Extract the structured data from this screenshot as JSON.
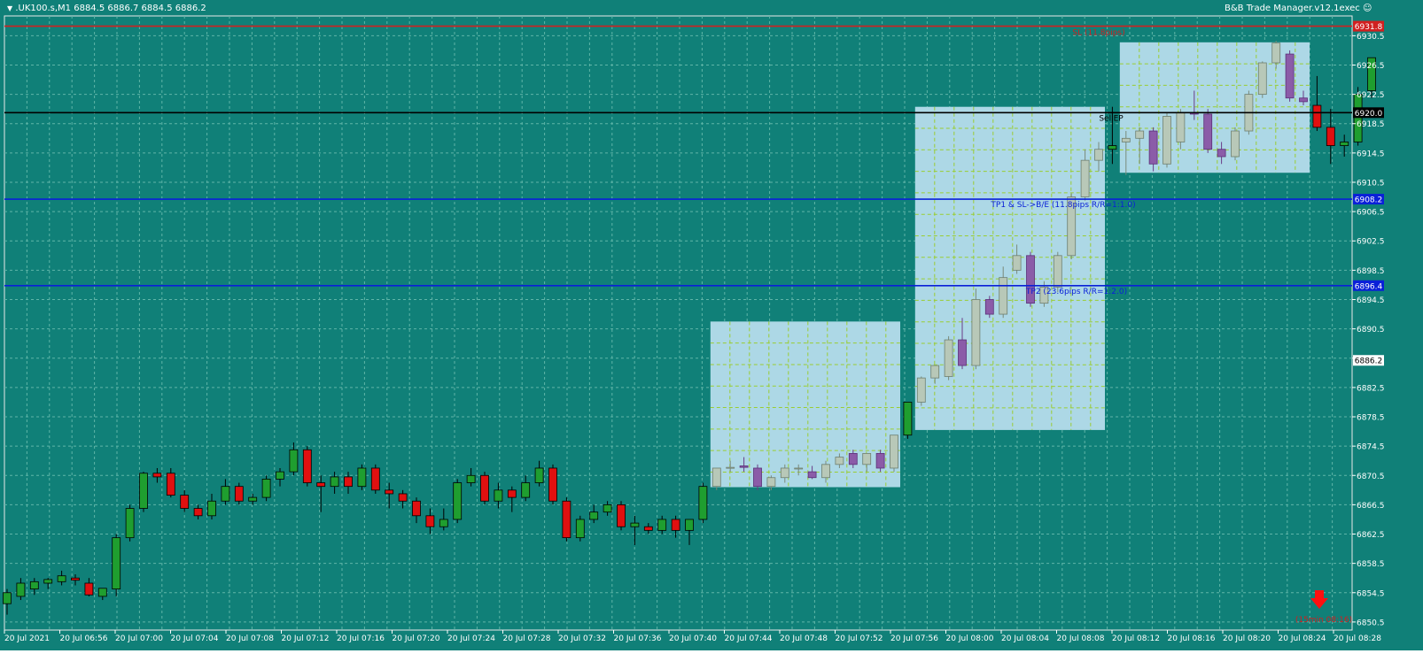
{
  "header": {
    "symbol_info": ".UK100.s,M1  6884.5 6886.7 6884.5 6886.2",
    "expert_name": "B&B Trade Manager.v12.1exec"
  },
  "colors": {
    "background": "#108078",
    "grid": "#5fb5a8",
    "bull": "#1f9e2f",
    "bear": "#e01010",
    "box_fill": "#add8e6",
    "box_grid": "#9acd32",
    "box_bull": "#b8c8b8",
    "box_bear": "#8b5ca8",
    "sl_line": "#d02020",
    "entry_line": "#000000",
    "tp_line": "#0a20d8"
  },
  "price_axis": {
    "ticks": [
      "6930.5",
      "6926.5",
      "6922.5",
      "6918.5",
      "6914.5",
      "6910.5",
      "6906.5",
      "6902.5",
      "6898.5",
      "6894.5",
      "6890.5",
      "6886.5",
      "6882.5",
      "6878.5",
      "6874.5",
      "6870.5",
      "6866.5",
      "6862.5",
      "6858.5",
      "6854.5",
      "6850.5"
    ]
  },
  "time_axis": {
    "labels": [
      "20 Jul 2021",
      "20 Jul 06:56",
      "20 Jul 07:00",
      "20 Jul 07:04",
      "20 Jul 07:08",
      "20 Jul 07:12",
      "20 Jul 07:16",
      "20 Jul 07:20",
      "20 Jul 07:24",
      "20 Jul 07:28",
      "20 Jul 07:32",
      "20 Jul 07:36",
      "20 Jul 07:40",
      "20 Jul 07:44",
      "20 Jul 07:48",
      "20 Jul 07:52",
      "20 Jul 07:56",
      "20 Jul 08:00",
      "20 Jul 08:04",
      "20 Jul 08:08",
      "20 Jul 08:12",
      "20 Jul 08:16",
      "20 Jul 08:20",
      "20 Jul 08:24",
      "20 Jul 08:28"
    ]
  },
  "levels": [
    {
      "name": "sl",
      "price": 6931.8,
      "label": "6931.8",
      "text": "SL (11.8pips)",
      "color": "#d02020",
      "text_color": "#d02020",
      "tag_fill": "#d02020"
    },
    {
      "name": "entry",
      "price": 6920.0,
      "label": "6920.0",
      "text": "SellEP",
      "color": "#000000",
      "text_color": "#000000",
      "tag_fill": "#000000"
    },
    {
      "name": "tp1",
      "price": 6908.2,
      "label": "6908.2",
      "text": "TP1 & SL->B/E (11.8pips R/R=1:1.0)",
      "color": "#0a20d8",
      "text_color": "#0a20d8",
      "tag_fill": "#0a20d8"
    },
    {
      "name": "tp2",
      "price": 6896.4,
      "label": "6896.4",
      "text": "TP2 (23.6pips R/R=1:2.0)",
      "color": "#0a20d8",
      "text_color": "#0a20d8",
      "tag_fill": "#0a20d8"
    }
  ],
  "current_price": "6886.2",
  "timer_text": "(15min 08:16)",
  "boxes": [
    {
      "from_bar": 52,
      "to_bar": 65,
      "top": 6891.5,
      "bottom": 6868.9
    },
    {
      "from_bar": 67,
      "to_bar": 80,
      "top": 6920.8,
      "bottom": 6876.7
    },
    {
      "from_bar": 82,
      "to_bar": 95,
      "top": 6929.6,
      "bottom": 6911.8
    }
  ],
  "candles": [
    [
      6853.0,
      6855.0,
      6851.5,
      6854.5
    ],
    [
      6854.0,
      6856.5,
      6853.5,
      6855.8
    ],
    [
      6855.0,
      6856.5,
      6854.2,
      6856.0
    ],
    [
      6855.8,
      6856.5,
      6855.0,
      6856.3
    ],
    [
      6856.0,
      6857.5,
      6855.5,
      6856.8
    ],
    [
      6856.5,
      6857.0,
      6855.5,
      6856.2
    ],
    [
      6855.8,
      6856.5,
      6854.0,
      6854.2
    ],
    [
      6854.0,
      6855.0,
      6853.5,
      6855.1
    ],
    [
      6855.0,
      6862.5,
      6854.0,
      6862.0
    ],
    [
      6862.0,
      6866.5,
      6861.5,
      6866.0
    ],
    [
      6866.0,
      6871.0,
      6865.5,
      6870.8
    ],
    [
      6870.8,
      6871.5,
      6869.5,
      6870.3
    ],
    [
      6870.8,
      6871.5,
      6867.5,
      6867.8
    ],
    [
      6867.8,
      6868.5,
      6865.5,
      6866.0
    ],
    [
      6866.0,
      6866.5,
      6864.5,
      6865.0
    ],
    [
      6865.0,
      6868.0,
      6864.5,
      6867.0
    ],
    [
      6867.0,
      6870.0,
      6866.5,
      6869.0
    ],
    [
      6869.0,
      6869.5,
      6866.5,
      6867.0
    ],
    [
      6867.0,
      6868.0,
      6866.5,
      6867.5
    ],
    [
      6867.5,
      6870.5,
      6867.0,
      6870.0
    ],
    [
      6870.0,
      6871.5,
      6869.0,
      6871.0
    ],
    [
      6871.0,
      6875.0,
      6870.5,
      6874.0
    ],
    [
      6874.0,
      6874.5,
      6869.0,
      6869.5
    ],
    [
      6869.5,
      6870.5,
      6865.5,
      6869.0
    ],
    [
      6869.0,
      6871.0,
      6868.0,
      6870.3
    ],
    [
      6870.3,
      6871.0,
      6868.0,
      6869.0
    ],
    [
      6869.0,
      6872.0,
      6868.5,
      6871.5
    ],
    [
      6871.5,
      6872.0,
      6868.0,
      6868.5
    ],
    [
      6868.5,
      6869.5,
      6866.0,
      6868.0
    ],
    [
      6868.0,
      6868.5,
      6866.0,
      6867.0
    ],
    [
      6867.0,
      6867.5,
      6864.0,
      6865.0
    ],
    [
      6865.0,
      6866.0,
      6862.5,
      6863.5
    ],
    [
      6863.5,
      6866.0,
      6863.0,
      6864.5
    ],
    [
      6864.5,
      6870.0,
      6864.0,
      6869.5
    ],
    [
      6869.5,
      6871.5,
      6869.0,
      6870.5
    ],
    [
      6870.5,
      6871.0,
      6866.5,
      6867.0
    ],
    [
      6867.0,
      6869.5,
      6866.0,
      6868.5
    ],
    [
      6868.5,
      6869.0,
      6865.5,
      6867.5
    ],
    [
      6867.5,
      6870.5,
      6867.0,
      6869.5
    ],
    [
      6869.5,
      6872.5,
      6869.0,
      6871.5
    ],
    [
      6871.5,
      6872.0,
      6866.5,
      6867.0
    ],
    [
      6867.0,
      6867.5,
      6861.5,
      6862.0
    ],
    [
      6862.0,
      6865.0,
      6861.5,
      6864.5
    ],
    [
      6864.5,
      6866.5,
      6864.0,
      6865.5
    ],
    [
      6865.5,
      6867.0,
      6865.0,
      6866.5
    ],
    [
      6866.5,
      6867.0,
      6863.0,
      6863.5
    ],
    [
      6863.5,
      6865.0,
      6861.0,
      6864.0
    ],
    [
      6863.5,
      6864.0,
      6862.5,
      6863.0
    ],
    [
      6863.0,
      6865.0,
      6862.5,
      6864.5
    ],
    [
      6864.5,
      6865.0,
      6862.0,
      6863.0
    ],
    [
      6863.0,
      6864.5,
      6861.0,
      6864.5
    ],
    [
      6864.5,
      6869.5,
      6864.0,
      6869.0
    ],
    [
      6869.0,
      6871.5,
      6868.5,
      6871.5
    ],
    [
      6871.5,
      6872.5,
      6871.0,
      6871.6
    ],
    [
      6871.8,
      6873.0,
      6871.0,
      6871.6
    ],
    [
      6871.5,
      6872.0,
      6868.5,
      6869.0
    ],
    [
      6869.0,
      6870.5,
      6868.5,
      6870.2
    ],
    [
      6870.2,
      6872.0,
      6869.5,
      6871.5
    ],
    [
      6871.5,
      6872.0,
      6870.5,
      6871.5
    ],
    [
      6871.0,
      6871.8,
      6870.0,
      6870.2
    ],
    [
      6870.2,
      6872.5,
      6869.5,
      6872.0
    ],
    [
      6872.0,
      6873.5,
      6871.5,
      6873.0
    ],
    [
      6873.5,
      6874.0,
      6871.5,
      6872.0
    ],
    [
      6872.0,
      6873.5,
      6871.0,
      6873.5
    ],
    [
      6873.5,
      6874.0,
      6871.0,
      6871.5
    ],
    [
      6871.5,
      6876.0,
      6871.0,
      6876.0
    ],
    [
      6876.0,
      6880.5,
      6875.5,
      6880.5
    ],
    [
      6880.5,
      6884.0,
      6880.0,
      6883.8
    ],
    [
      6883.8,
      6885.5,
      6883.0,
      6885.5
    ],
    [
      6884.0,
      6889.5,
      6883.5,
      6889.0
    ],
    [
      6889.0,
      6892.0,
      6885.0,
      6885.5
    ],
    [
      6885.5,
      6896.0,
      6885.0,
      6894.5
    ],
    [
      6894.5,
      6895.0,
      6892.0,
      6892.5
    ],
    [
      6892.5,
      6899.0,
      6892.0,
      6897.5
    ],
    [
      6898.5,
      6902.0,
      6898.0,
      6900.5
    ],
    [
      6900.5,
      6901.0,
      6893.5,
      6894.0
    ],
    [
      6894.0,
      6897.0,
      6893.5,
      6896.2
    ],
    [
      6896.2,
      6901.0,
      6895.5,
      6900.5
    ],
    [
      6900.5,
      6909.0,
      6900.0,
      6908.5
    ],
    [
      6908.5,
      6915.0,
      6908.0,
      6913.5
    ],
    [
      6913.5,
      6916.0,
      6912.0,
      6915.0
    ],
    [
      6915.0,
      6920.8,
      6913.0,
      6915.5
    ],
    [
      6916.0,
      6917.5,
      6911.5,
      6916.5
    ],
    [
      6916.5,
      6918.0,
      6913.0,
      6917.5
    ],
    [
      6917.5,
      6918.0,
      6912.0,
      6913.0
    ],
    [
      6913.0,
      6920.0,
      6912.5,
      6919.5
    ],
    [
      6916.0,
      6920.5,
      6915.0,
      6920.0
    ],
    [
      6920.0,
      6923.0,
      6919.0,
      6919.8
    ],
    [
      6919.8,
      6920.5,
      6914.5,
      6915.0
    ],
    [
      6915.0,
      6916.0,
      6913.0,
      6914.0
    ],
    [
      6914.0,
      6918.0,
      6913.5,
      6917.5
    ],
    [
      6917.5,
      6923.0,
      6917.0,
      6922.5
    ],
    [
      6922.5,
      6927.0,
      6922.0,
      6926.8
    ],
    [
      6926.8,
      6929.8,
      6926.0,
      6929.5
    ],
    [
      6928.0,
      6928.5,
      6921.5,
      6922.0
    ],
    [
      6922.0,
      6923.0,
      6921.0,
      6921.5
    ],
    [
      6921.0,
      6925.0,
      6917.5,
      6918.0
    ],
    [
      6918.0,
      6920.5,
      6913.0,
      6915.5
    ],
    [
      6915.5,
      6917.0,
      6914.0,
      6916.0
    ],
    [
      6916.0,
      6923.5,
      6915.5,
      6922.5
    ],
    [
      6923.0,
      6927.5,
      6922.0,
      6927.5
    ]
  ]
}
